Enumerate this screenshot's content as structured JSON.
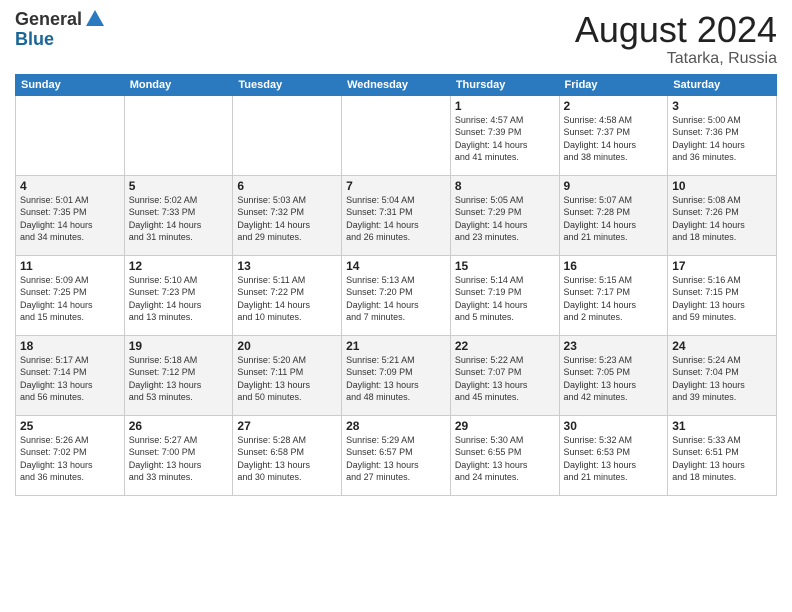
{
  "header": {
    "logo_general": "General",
    "logo_blue": "Blue",
    "month_title": "August 2024",
    "location": "Tatarka, Russia"
  },
  "days_of_week": [
    "Sunday",
    "Monday",
    "Tuesday",
    "Wednesday",
    "Thursday",
    "Friday",
    "Saturday"
  ],
  "weeks": [
    [
      {
        "day": "",
        "info": ""
      },
      {
        "day": "",
        "info": ""
      },
      {
        "day": "",
        "info": ""
      },
      {
        "day": "",
        "info": ""
      },
      {
        "day": "1",
        "info": "Sunrise: 4:57 AM\nSunset: 7:39 PM\nDaylight: 14 hours\nand 41 minutes."
      },
      {
        "day": "2",
        "info": "Sunrise: 4:58 AM\nSunset: 7:37 PM\nDaylight: 14 hours\nand 38 minutes."
      },
      {
        "day": "3",
        "info": "Sunrise: 5:00 AM\nSunset: 7:36 PM\nDaylight: 14 hours\nand 36 minutes."
      }
    ],
    [
      {
        "day": "4",
        "info": "Sunrise: 5:01 AM\nSunset: 7:35 PM\nDaylight: 14 hours\nand 34 minutes."
      },
      {
        "day": "5",
        "info": "Sunrise: 5:02 AM\nSunset: 7:33 PM\nDaylight: 14 hours\nand 31 minutes."
      },
      {
        "day": "6",
        "info": "Sunrise: 5:03 AM\nSunset: 7:32 PM\nDaylight: 14 hours\nand 29 minutes."
      },
      {
        "day": "7",
        "info": "Sunrise: 5:04 AM\nSunset: 7:31 PM\nDaylight: 14 hours\nand 26 minutes."
      },
      {
        "day": "8",
        "info": "Sunrise: 5:05 AM\nSunset: 7:29 PM\nDaylight: 14 hours\nand 23 minutes."
      },
      {
        "day": "9",
        "info": "Sunrise: 5:07 AM\nSunset: 7:28 PM\nDaylight: 14 hours\nand 21 minutes."
      },
      {
        "day": "10",
        "info": "Sunrise: 5:08 AM\nSunset: 7:26 PM\nDaylight: 14 hours\nand 18 minutes."
      }
    ],
    [
      {
        "day": "11",
        "info": "Sunrise: 5:09 AM\nSunset: 7:25 PM\nDaylight: 14 hours\nand 15 minutes."
      },
      {
        "day": "12",
        "info": "Sunrise: 5:10 AM\nSunset: 7:23 PM\nDaylight: 14 hours\nand 13 minutes."
      },
      {
        "day": "13",
        "info": "Sunrise: 5:11 AM\nSunset: 7:22 PM\nDaylight: 14 hours\nand 10 minutes."
      },
      {
        "day": "14",
        "info": "Sunrise: 5:13 AM\nSunset: 7:20 PM\nDaylight: 14 hours\nand 7 minutes."
      },
      {
        "day": "15",
        "info": "Sunrise: 5:14 AM\nSunset: 7:19 PM\nDaylight: 14 hours\nand 5 minutes."
      },
      {
        "day": "16",
        "info": "Sunrise: 5:15 AM\nSunset: 7:17 PM\nDaylight: 14 hours\nand 2 minutes."
      },
      {
        "day": "17",
        "info": "Sunrise: 5:16 AM\nSunset: 7:15 PM\nDaylight: 13 hours\nand 59 minutes."
      }
    ],
    [
      {
        "day": "18",
        "info": "Sunrise: 5:17 AM\nSunset: 7:14 PM\nDaylight: 13 hours\nand 56 minutes."
      },
      {
        "day": "19",
        "info": "Sunrise: 5:18 AM\nSunset: 7:12 PM\nDaylight: 13 hours\nand 53 minutes."
      },
      {
        "day": "20",
        "info": "Sunrise: 5:20 AM\nSunset: 7:11 PM\nDaylight: 13 hours\nand 50 minutes."
      },
      {
        "day": "21",
        "info": "Sunrise: 5:21 AM\nSunset: 7:09 PM\nDaylight: 13 hours\nand 48 minutes."
      },
      {
        "day": "22",
        "info": "Sunrise: 5:22 AM\nSunset: 7:07 PM\nDaylight: 13 hours\nand 45 minutes."
      },
      {
        "day": "23",
        "info": "Sunrise: 5:23 AM\nSunset: 7:05 PM\nDaylight: 13 hours\nand 42 minutes."
      },
      {
        "day": "24",
        "info": "Sunrise: 5:24 AM\nSunset: 7:04 PM\nDaylight: 13 hours\nand 39 minutes."
      }
    ],
    [
      {
        "day": "25",
        "info": "Sunrise: 5:26 AM\nSunset: 7:02 PM\nDaylight: 13 hours\nand 36 minutes."
      },
      {
        "day": "26",
        "info": "Sunrise: 5:27 AM\nSunset: 7:00 PM\nDaylight: 13 hours\nand 33 minutes."
      },
      {
        "day": "27",
        "info": "Sunrise: 5:28 AM\nSunset: 6:58 PM\nDaylight: 13 hours\nand 30 minutes."
      },
      {
        "day": "28",
        "info": "Sunrise: 5:29 AM\nSunset: 6:57 PM\nDaylight: 13 hours\nand 27 minutes."
      },
      {
        "day": "29",
        "info": "Sunrise: 5:30 AM\nSunset: 6:55 PM\nDaylight: 13 hours\nand 24 minutes."
      },
      {
        "day": "30",
        "info": "Sunrise: 5:32 AM\nSunset: 6:53 PM\nDaylight: 13 hours\nand 21 minutes."
      },
      {
        "day": "31",
        "info": "Sunrise: 5:33 AM\nSunset: 6:51 PM\nDaylight: 13 hours\nand 18 minutes."
      }
    ]
  ]
}
